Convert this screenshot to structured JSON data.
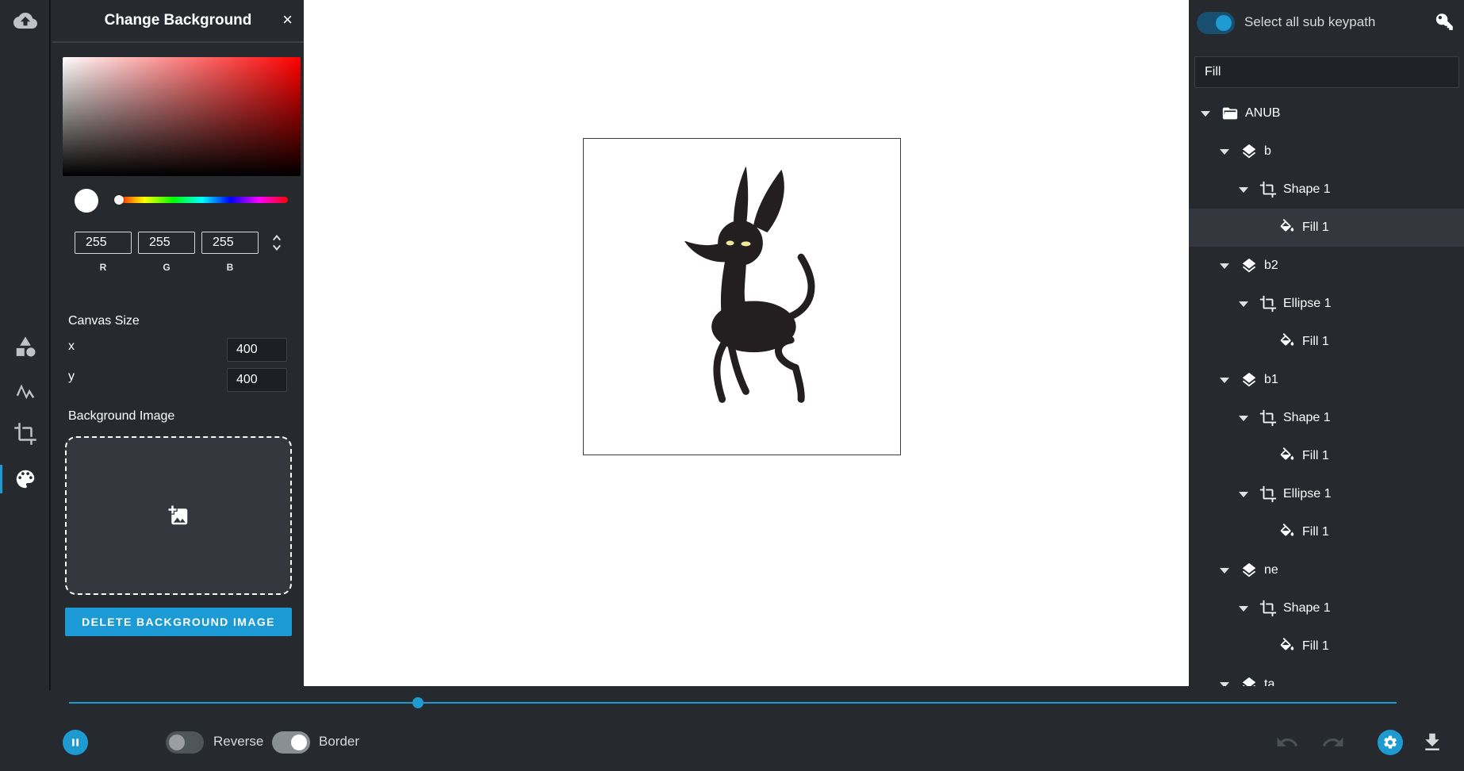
{
  "left_rail": {
    "items": [
      {
        "icon": "cloud-upload-icon"
      },
      {
        "icon": "shapes-icon"
      },
      {
        "icon": "path-icon"
      },
      {
        "icon": "crop-icon"
      },
      {
        "icon": "palette-icon",
        "active": true
      }
    ]
  },
  "panel": {
    "title": "Change Background",
    "close_label": "×",
    "color": {
      "r": "255",
      "g": "255",
      "b": "255",
      "r_label": "R",
      "g_label": "G",
      "b_label": "B",
      "swatch_hex": "#ffffff"
    },
    "canvas_size": {
      "label": "Canvas Size",
      "x_label": "x",
      "x_value": "400",
      "y_label": "y",
      "y_value": "400"
    },
    "background_image": {
      "label": "Background Image",
      "delete_label": "DELETE BACKGROUND IMAGE"
    }
  },
  "layers": {
    "select_all_label": "Select all sub keypath",
    "select_all_on": true,
    "filter_value": "Fill",
    "tree": [
      {
        "label": "ANUB",
        "icon": "folder-open-icon",
        "depth": 0,
        "caret": true
      },
      {
        "label": "b",
        "icon": "layers-icon",
        "depth": 1,
        "caret": true
      },
      {
        "label": "Shape 1",
        "icon": "crop-icon",
        "depth": 2,
        "caret": true
      },
      {
        "label": "Fill 1",
        "icon": "fill-icon",
        "depth": 3,
        "caret": false,
        "selected": true
      },
      {
        "label": "b2",
        "icon": "layers-icon",
        "depth": 1,
        "caret": true
      },
      {
        "label": "Ellipse 1",
        "icon": "crop-icon",
        "depth": 2,
        "caret": true
      },
      {
        "label": "Fill 1",
        "icon": "fill-icon",
        "depth": 3,
        "caret": false
      },
      {
        "label": "b1",
        "icon": "layers-icon",
        "depth": 1,
        "caret": true
      },
      {
        "label": "Shape 1",
        "icon": "crop-icon",
        "depth": 2,
        "caret": true
      },
      {
        "label": "Fill 1",
        "icon": "fill-icon",
        "depth": 3,
        "caret": false
      },
      {
        "label": "Ellipse 1",
        "icon": "crop-icon",
        "depth": 2,
        "caret": true
      },
      {
        "label": "Fill 1",
        "icon": "fill-icon",
        "depth": 3,
        "caret": false
      },
      {
        "label": "ne",
        "icon": "layers-icon",
        "depth": 1,
        "caret": true
      },
      {
        "label": "Shape 1",
        "icon": "crop-icon",
        "depth": 2,
        "caret": true
      },
      {
        "label": "Fill 1",
        "icon": "fill-icon",
        "depth": 3,
        "caret": false
      },
      {
        "label": "ta",
        "icon": "layers-icon",
        "depth": 1,
        "caret": true
      }
    ]
  },
  "bottom_bar": {
    "playback_state": "playing",
    "timeline_progress": 0.263,
    "reverse_label": "Reverse",
    "reverse_on": false,
    "border_label": "Border",
    "border_on": true
  },
  "colors": {
    "accent": "#1d9bd1",
    "panel_bg": "#262a2f",
    "canvas_bg": "#ffffff"
  }
}
